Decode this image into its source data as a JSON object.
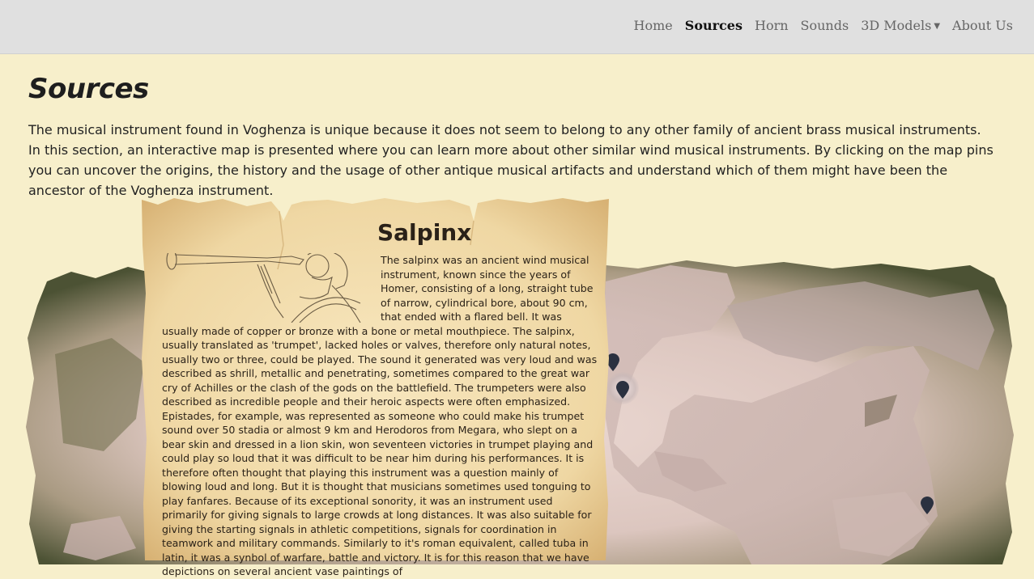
{
  "nav": {
    "items": [
      {
        "label": "Home",
        "active": false
      },
      {
        "label": "Sources",
        "active": true
      },
      {
        "label": "Horn",
        "active": false
      },
      {
        "label": "Sounds",
        "active": false
      },
      {
        "label": "3D Models",
        "active": false,
        "dropdown": true
      },
      {
        "label": "About Us",
        "active": false
      }
    ]
  },
  "page": {
    "title": "Sources",
    "intro": "The musical instrument found in Voghenza is unique because it does not seem to belong to any other family of ancient brass musical instruments. In this section, an interactive map is presented where you can learn more about other similar wind musical instruments. By clicking on the map pins you can uncover the origins, the history and the usage of other antique musical artifacts and understand which of them might have been the ancestor of the Voghenza instrument."
  },
  "popup": {
    "title": "Salpinx",
    "illustration_icon": "trumpeter-illustration",
    "body": "The salpinx was an ancient wind musical instrument, known since the years of Homer, consisting of a long, straight tube of narrow, cylindrical bore, about 90 cm, that ended with a flared bell. It was usually made of copper or bronze with a bone or metal mouthpiece. The salpinx, usually translated as 'trumpet', lacked holes or valves, therefore only natural notes, usually two or three, could be played. The sound it generated was very loud and was described as shrill, metallic and penetrating, sometimes compared to the great war cry of Achilles or the clash of the gods on the battlefield. The trumpeters were also described as incredible people and their heroic aspects were often emphasized. Epistades, for example, was represented as someone who could make his trumpet sound over 50 stadia or almost 9 km and Herodoros from Megara, who slept on a bear skin and dressed in a lion skin, won seventeen victories in trumpet playing and could play so loud that it was difficult to be near him during his performances. It is therefore often thought that playing this instrument was a question mainly of blowing loud and long. But it is thought that musicians sometimes used tonguing to play fanfares. Because of its exceptional sonority, it was an instrument used primarily for giving signals to large crowds at long distances. It was also suitable for giving the starting signals in athletic competitions, signals for coordination in teamwork and military commands. Similarly to it's roman equivalent, called tuba in latin, it was a synbol of warfare, battle and victory. It is for this reason that we have depictions on several ancient vase paintings of"
  },
  "map": {
    "pin_icon": "map-pin-icon",
    "pins": [
      "pin-north",
      "pin-greece-active",
      "pin-east"
    ],
    "colors": {
      "pin": "#2b3140",
      "land_dark": "#5f6240",
      "sea": "#e6d2cd"
    }
  }
}
